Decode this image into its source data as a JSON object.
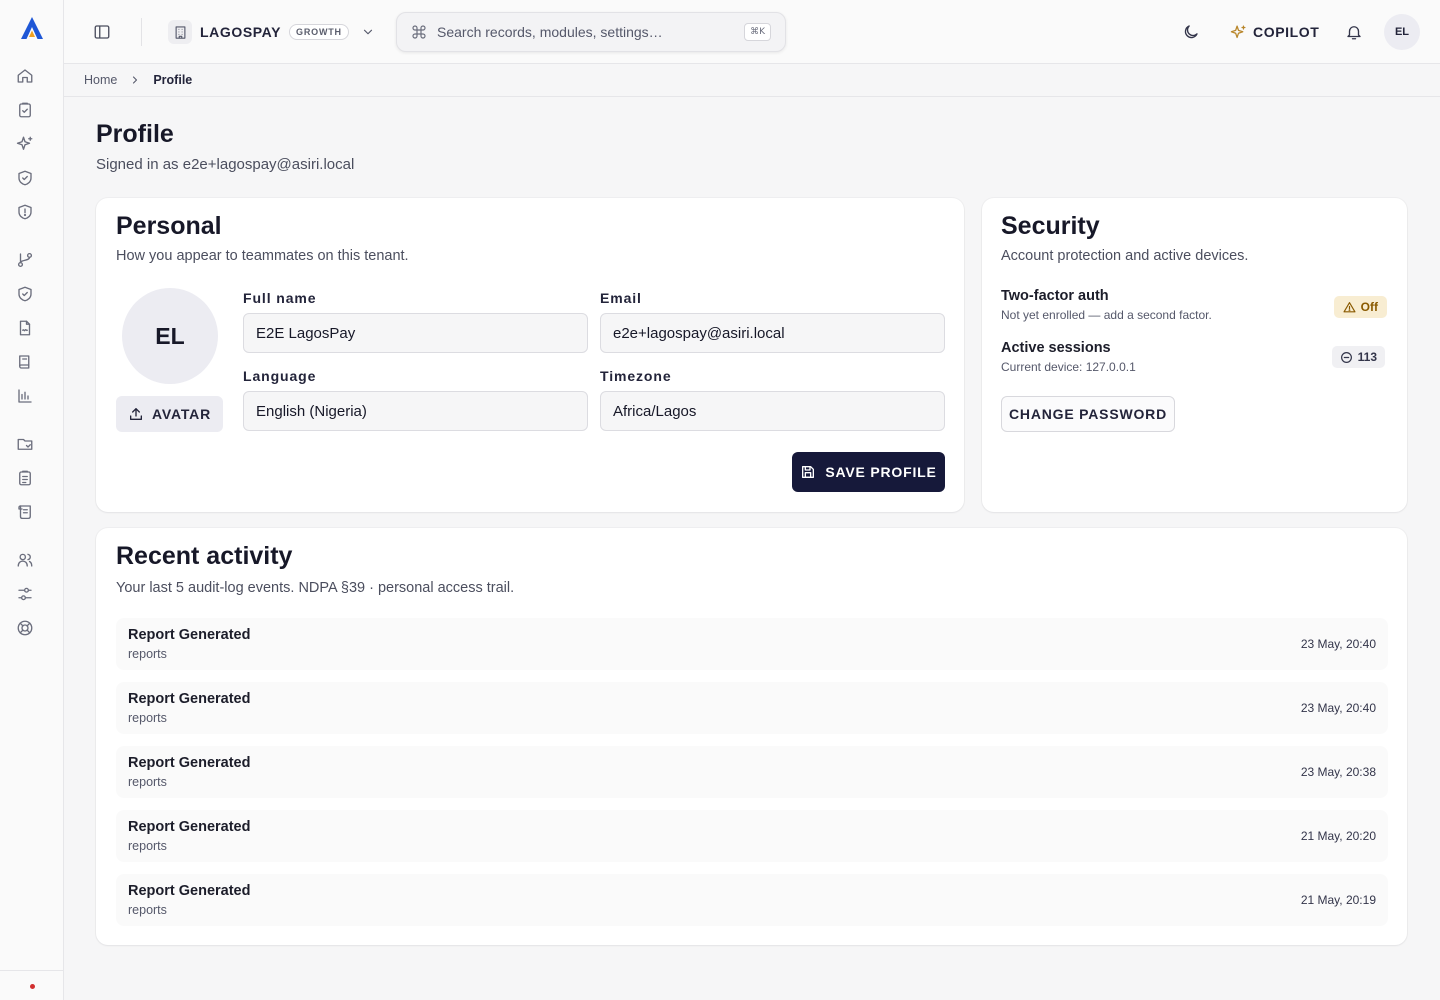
{
  "topbar": {
    "tenant_name": "LAGOSPAY",
    "plan": "GROWTH",
    "search_placeholder": "Search records, modules, settings…",
    "search_shortcut": "⌘K",
    "copilot_label": "COPILOT",
    "user_initials": "EL"
  },
  "breadcrumb": {
    "home": "Home",
    "current": "Profile"
  },
  "page": {
    "title": "Profile",
    "subtitle": "Signed in as e2e+lagospay@asiri.local"
  },
  "personal": {
    "title": "Personal",
    "description": "How you appear to teammates on this tenant.",
    "avatar_initials": "EL",
    "avatar_button": "AVATAR",
    "full_name_label": "Full name",
    "full_name_value": "E2E LagosPay",
    "email_label": "Email",
    "email_value": "e2e+lagospay@asiri.local",
    "language_label": "Language",
    "language_value": "English (Nigeria)",
    "timezone_label": "Timezone",
    "timezone_value": "Africa/Lagos",
    "save_button": "SAVE PROFILE"
  },
  "security": {
    "title": "Security",
    "description": "Account protection and active devices.",
    "two_factor_title": "Two-factor auth",
    "two_factor_sub": "Not yet enrolled — add a second factor.",
    "two_factor_badge": "Off",
    "sessions_title": "Active sessions",
    "sessions_sub": "Current device: 127.0.0.1",
    "sessions_count": "113",
    "change_password": "CHANGE PASSWORD"
  },
  "activity": {
    "title": "Recent activity",
    "description": "Your last 5 audit-log events. NDPA §39 · personal access trail.",
    "rows": [
      {
        "event": "Report Generated",
        "module": "reports",
        "time": "23 May, 20:40"
      },
      {
        "event": "Report Generated",
        "module": "reports",
        "time": "23 May, 20:40"
      },
      {
        "event": "Report Generated",
        "module": "reports",
        "time": "23 May, 20:38"
      },
      {
        "event": "Report Generated",
        "module": "reports",
        "time": "21 May, 20:20"
      },
      {
        "event": "Report Generated",
        "module": "reports",
        "time": "21 May, 20:19"
      }
    ]
  },
  "colors": {
    "accent_primary": "#16193a",
    "warning_bg": "#f8edd2",
    "warning_text": "#8a5a00",
    "status_dot": "#d12f2f",
    "logo_blue": "#1f57d6",
    "logo_orange": "#f0a020"
  },
  "icons": {
    "rail": [
      "home-icon",
      "clipboard-check-icon",
      "sparkles-icon",
      "shield-check-icon",
      "shield-icon",
      "git-branch-icon",
      "shield-check-icon",
      "file-signature-icon",
      "book-icon",
      "bar-chart-icon",
      "folder-icon",
      "clipboard-list-icon",
      "scroll-icon",
      "users-icon",
      "sliders-icon",
      "lifebuoy-icon"
    ]
  }
}
